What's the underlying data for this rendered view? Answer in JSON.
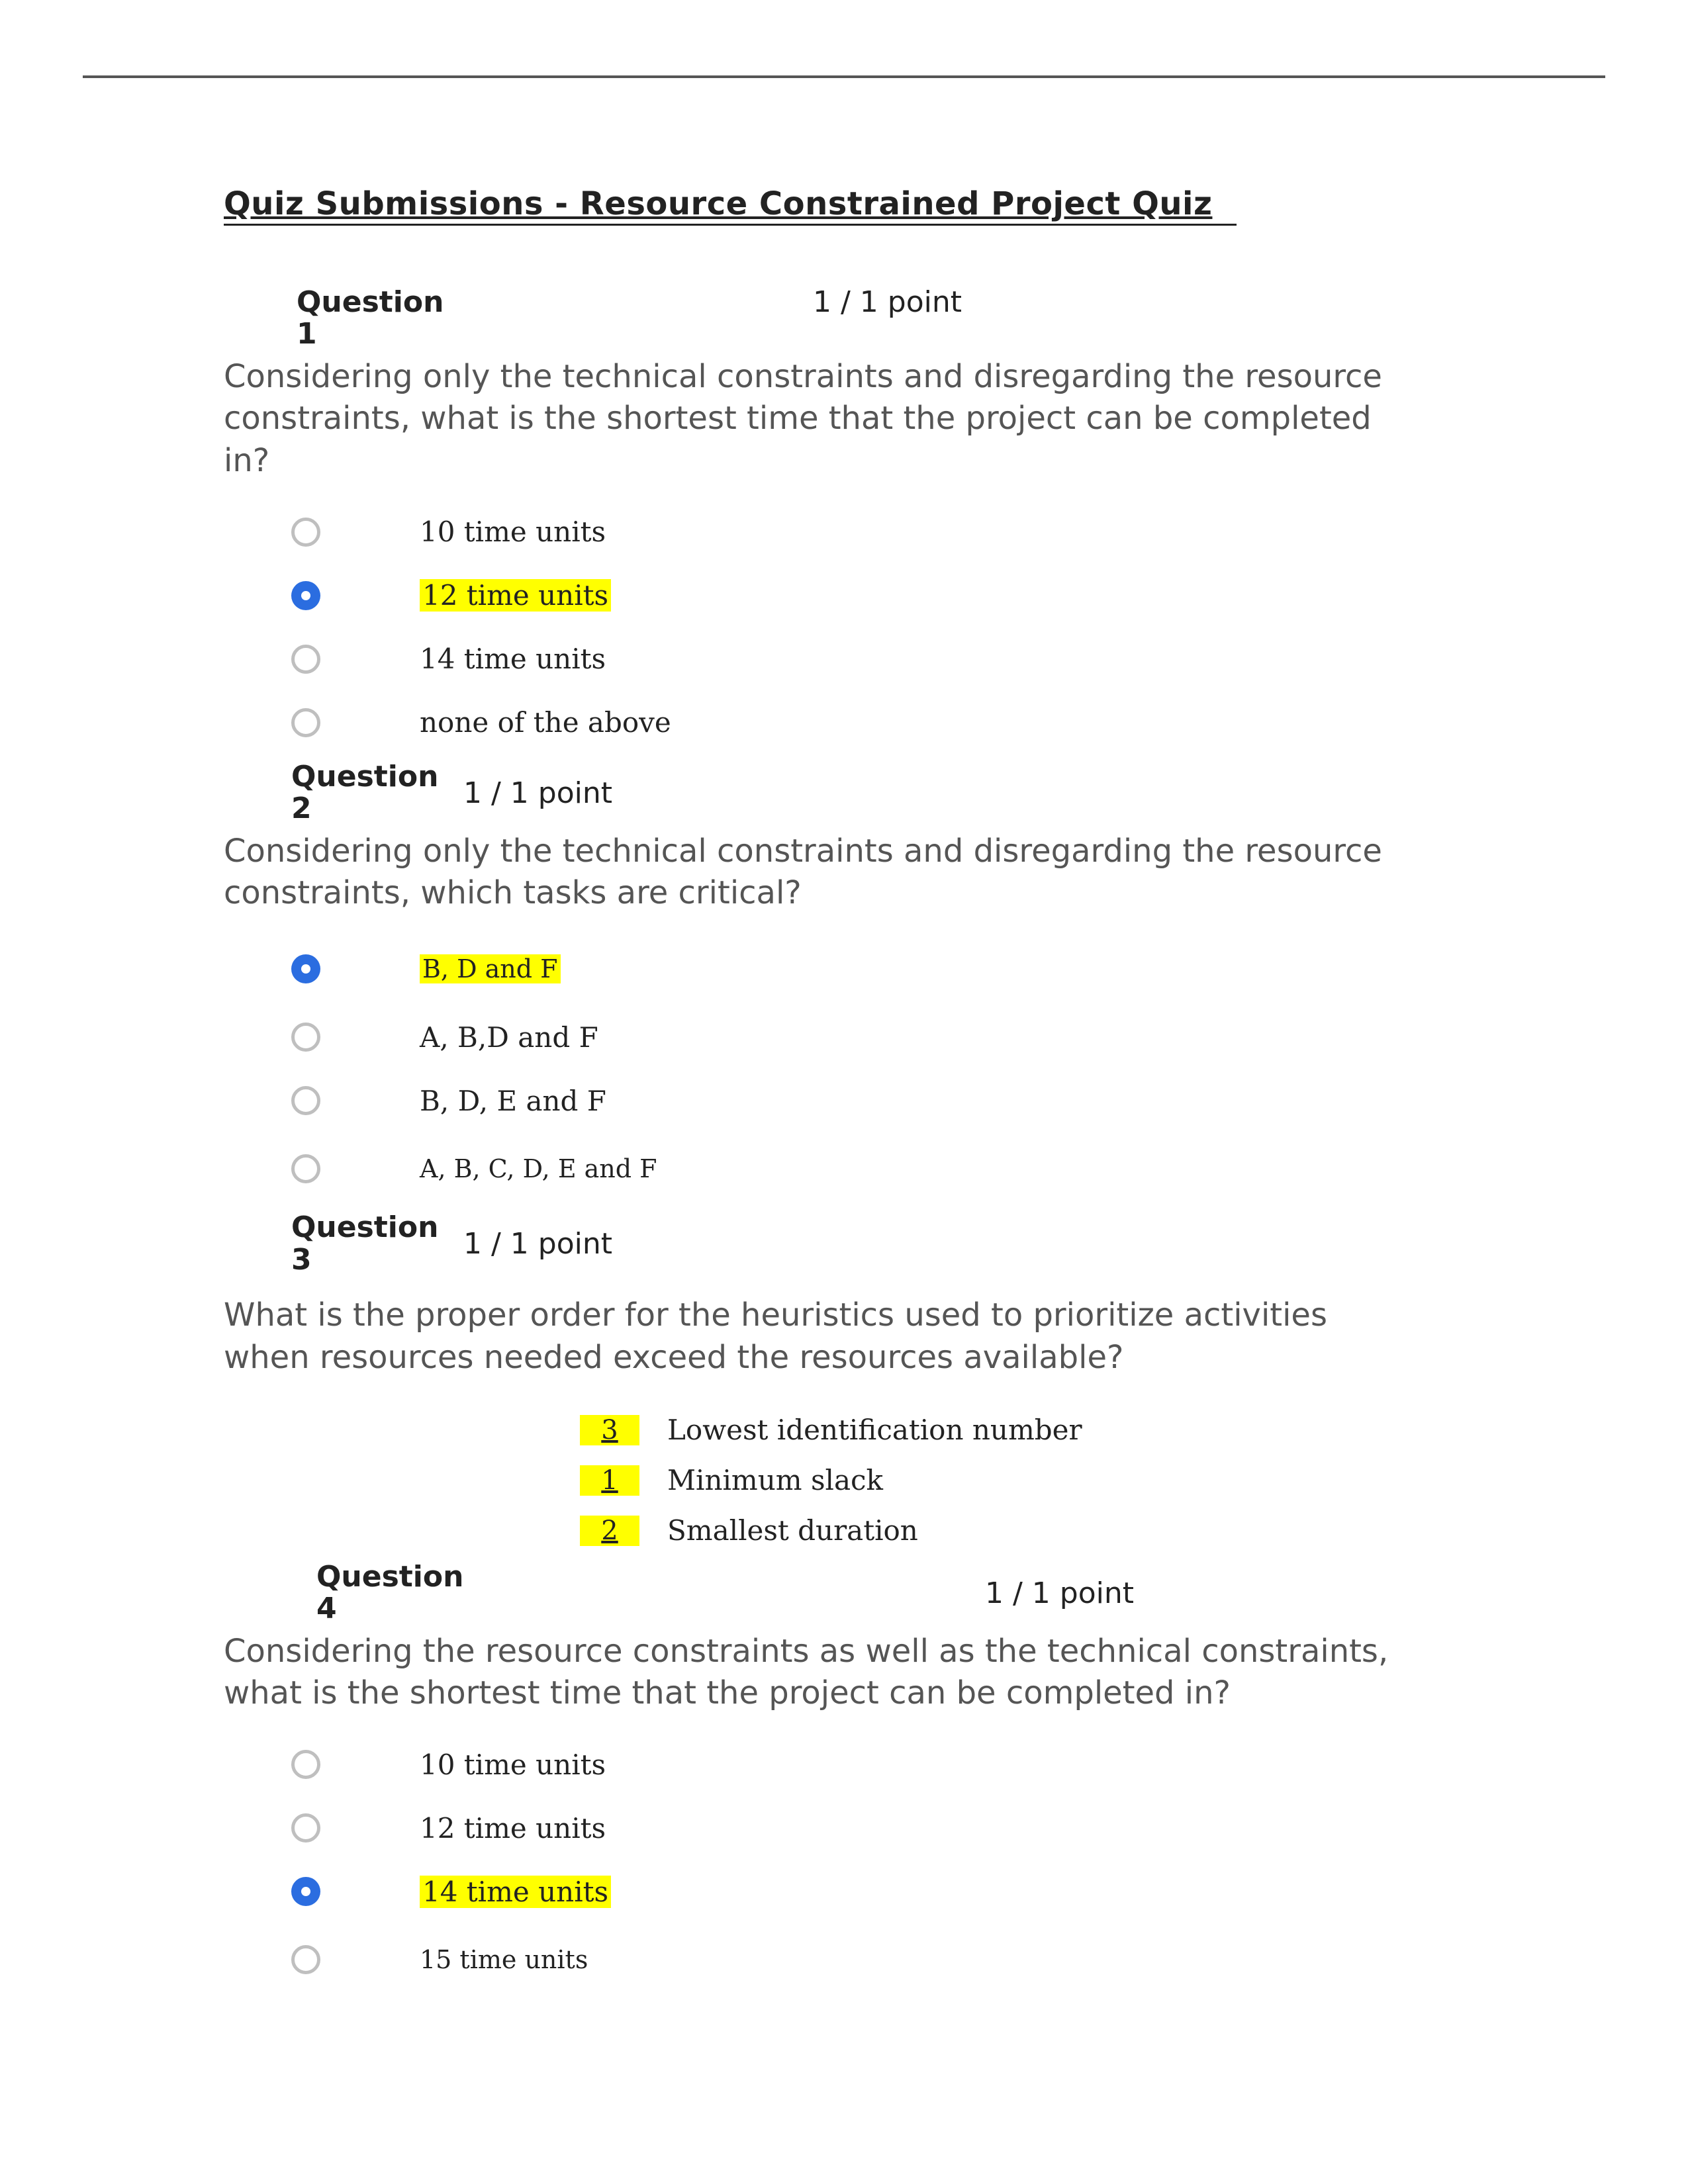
{
  "title": "Quiz Submissions - Resource Constrained Project Quiz",
  "q1": {
    "label": "Question 1",
    "points": "1 / 1 point",
    "text": "Considering only the technical constraints and disregarding the resource constraints, what is the shortest time that the project can be completed in?",
    "opts": [
      "10 time units",
      "12 time units",
      "14 time units",
      "none of the above"
    ]
  },
  "q2": {
    "label": "Question 2",
    "points": "1 / 1 point",
    "text": "Considering only the technical constraints and disregarding the resource constraints, which tasks are critical?",
    "opts": [
      "B, D and F",
      "A, B,D and F",
      "B, D, E and F",
      "A, B, C, D, E and F"
    ]
  },
  "q3": {
    "label": "Question 3",
    "points": "1 / 1 point",
    "text": "What is the proper order for the heuristics used to prioritize activities when resources needed exceed the resources available?",
    "orders": [
      {
        "num": "  3  ",
        "txt": "Lowest identification number"
      },
      {
        "num": "  1  ",
        "txt": "Minimum slack"
      },
      {
        "num": "  2  ",
        "txt": "Smallest duration"
      }
    ]
  },
  "q4": {
    "label": "Question 4",
    "points": "1 / 1 point",
    "text": "Considering the resource constraints as well as the technical constraints, what is the shortest time that the project can be completed in?",
    "opts": [
      "10 time units",
      "12 time units",
      "14 time units",
      "15 time units"
    ]
  }
}
